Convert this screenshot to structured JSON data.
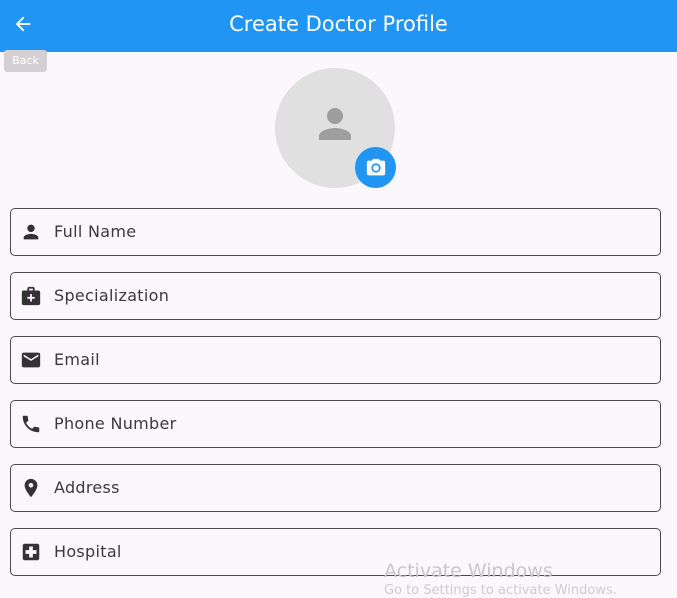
{
  "appbar": {
    "title": "Create Doctor Profile",
    "back_icon": "arrow-back-icon",
    "back_tooltip": "Back",
    "color": "#2195f3"
  },
  "avatar": {
    "placeholder_icon": "person-icon",
    "camera_icon": "camera-icon"
  },
  "form": {
    "fields": [
      {
        "label": "Full Name",
        "icon": "person-icon"
      },
      {
        "label": "Specialization",
        "icon": "medical-bag-icon"
      },
      {
        "label": "Email",
        "icon": "email-icon"
      },
      {
        "label": "Phone Number",
        "icon": "phone-icon"
      },
      {
        "label": "Address",
        "icon": "location-pin-icon"
      },
      {
        "label": "Hospital",
        "icon": "hospital-icon"
      }
    ]
  },
  "watermark": {
    "title": "Activate Windows",
    "subtitle": "Go to Settings to activate Windows."
  }
}
